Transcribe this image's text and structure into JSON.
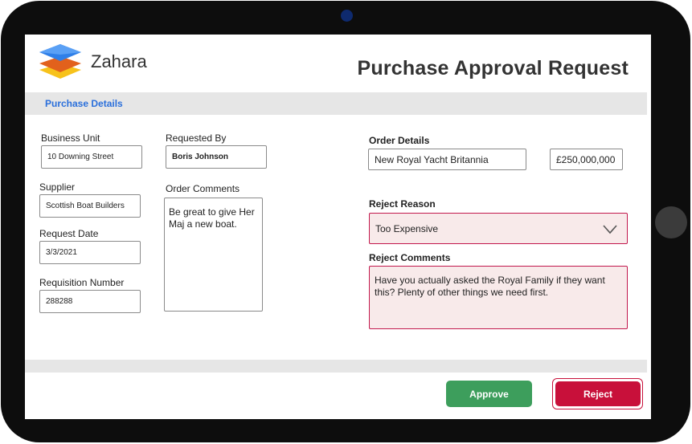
{
  "app": {
    "brand": "Zahara",
    "title": "Purchase Approval Request"
  },
  "section": {
    "header": "Purchase Details"
  },
  "fields": {
    "business_unit": {
      "label": "Business Unit",
      "value": "10 Downing Street"
    },
    "requested_by": {
      "label": "Requested By",
      "value": "Boris Johnson"
    },
    "supplier": {
      "label": "Supplier",
      "value": "Scottish Boat Builders"
    },
    "order_comments": {
      "label": "Order Comments",
      "value": "Be great to give Her Maj a new boat."
    },
    "request_date": {
      "label": "Request Date",
      "value": "3/3/2021"
    },
    "requisition_number": {
      "label": "Requisition Number",
      "value": "288288"
    },
    "order_details": {
      "label": "Order Details",
      "item": "New Royal Yacht Britannia",
      "amount": "£250,000,000"
    },
    "reject_reason": {
      "label": "Reject Reason",
      "value": "Too Expensive"
    },
    "reject_comments": {
      "label": "Reject Comments",
      "value": "Have you actually asked the Royal Family if they want this? Plenty of other things we need first."
    }
  },
  "actions": {
    "approve": "Approve",
    "reject": "Reject"
  },
  "colors": {
    "accent_blue": "#2a6fdb",
    "approve_green": "#3d9e5c",
    "reject_red": "#c8103a",
    "error_bg": "#f8eaea"
  }
}
